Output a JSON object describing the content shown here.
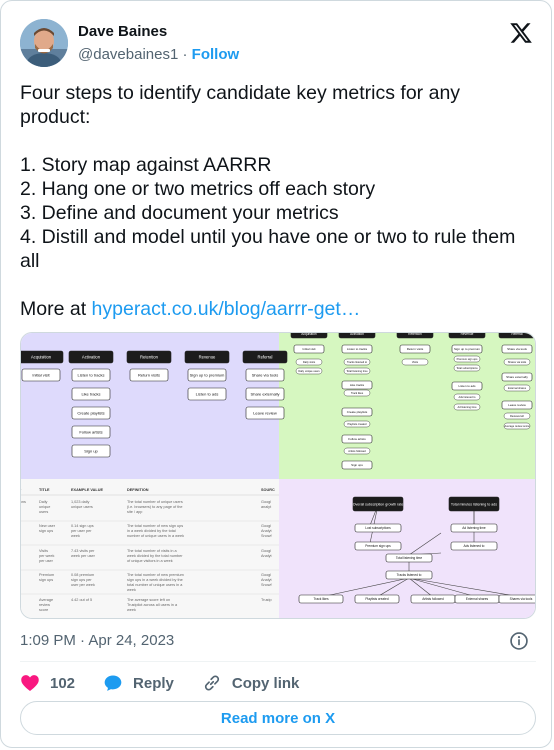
{
  "author": {
    "name": "Dave Baines",
    "handle": "@davebaines1",
    "separator": " · ",
    "follow_label": "Follow"
  },
  "tweet": {
    "text_main": "Four steps to identify candidate key metrics for any product:\n\n1. Story map against AARRR\n2. Hang one or two metrics off each story\n3. Define and document your metrics\n4. Distill and model until you have one or two to rule them all\n\nMore at ",
    "link_text": "hyperact.co.uk/blog/aarrr-get…"
  },
  "media": {
    "story_map": {
      "headers": [
        "Acquisition",
        "Activation",
        "Retention",
        "Revenue",
        "Referral"
      ],
      "stories": [
        "Initial visit",
        "Listen to tracks",
        "Like tracks",
        "Create playlists",
        "Follow artists",
        "Sign up",
        "Return visits",
        "Sign up to premium",
        "Listen to ads",
        "Share via tools",
        "Share externally",
        "Leave review"
      ]
    },
    "green_map": {
      "headers": [
        "Acquisition",
        "Activation",
        "Retention",
        "Revenue",
        "Referral"
      ],
      "stories": [
        "Initial visit",
        "Listen to tracks",
        "Like tracks",
        "Create playlists",
        "Follow artists",
        "Sign ups",
        "Return visits",
        "Sign up to premium",
        "Listen to ads",
        "Share via tools",
        "Share externally",
        "Leave review"
      ],
      "metrics": [
        "Daily visits",
        "Daily unique users",
        "Tracks listened to",
        "Total listening time",
        "Track likes",
        "Playlists created",
        "Artists followed",
        "Visits",
        "Premium sign ups",
        "Total subscriptions",
        "Ads listened to",
        "Ad listening time",
        "Shares via tools",
        "Shares via tools",
        "External shares",
        "Reviews left",
        "Average review score"
      ]
    },
    "table": {
      "headers": [
        "ey",
        "TITLE",
        "EXAMPLE VALUE",
        "DEFINITION",
        "SOURC"
      ],
      "rows": [
        [
          "itions",
          "Daily unique users",
          "1,023 daily unique users",
          "The total number of unique users (i.e. browsers) to any page of the site / app",
          "Googl analyt"
        ],
        [
          "",
          "New user sign ups",
          "0.14 sign ups per user per week",
          "The total number of new sign ups in a week divided by the total number of unique users in a week",
          "Googl Analyt Snowf"
        ],
        [
          "on",
          "Visits per week per user",
          "7.43 visits per week per user",
          "The total number of visits in a week divided by the total number of unique visitors in a week",
          "Googl Analyt"
        ],
        [
          "e",
          "Premium sign ups",
          "0.08 premium sign ups per user per week",
          "The total number of new premium sign ups in a week divided by the total number of unique users in a week",
          "Googl Analyt Snowf"
        ],
        [
          "",
          "Average review score",
          "4.42 out of 5",
          "The average score left on Trustpilot across all users in a week",
          "Trustp"
        ]
      ]
    },
    "tree": {
      "top_nodes": [
        "Overall subscription growth rate",
        "Total minutes listening to ads"
      ],
      "mid_nodes": [
        "Lost subscriptions",
        "Premium sign ups",
        "Ad listening time",
        "Ads listened to"
      ],
      "center_nodes": [
        "Total listening time",
        "Tracks listened to"
      ],
      "leaf_nodes": [
        "Track likes",
        "Playlists created",
        "Artists followed",
        "External shares",
        "Shares via tools"
      ]
    }
  },
  "meta": {
    "timestamp": "1:09 PM · Apr 24, 2023"
  },
  "actions": {
    "likes": "102",
    "reply_label": "Reply",
    "copy_label": "Copy link",
    "read_more_label": "Read more on X"
  },
  "colors": {
    "accent": "#1d9bf0",
    "like": "#f91880",
    "panel_purple": "#dedafc",
    "panel_green": "#d6f7c0",
    "panel_lilac": "#f0e3fb",
    "panel_gray": "#f7f7f7",
    "node_dark": "#1c1c1c"
  }
}
